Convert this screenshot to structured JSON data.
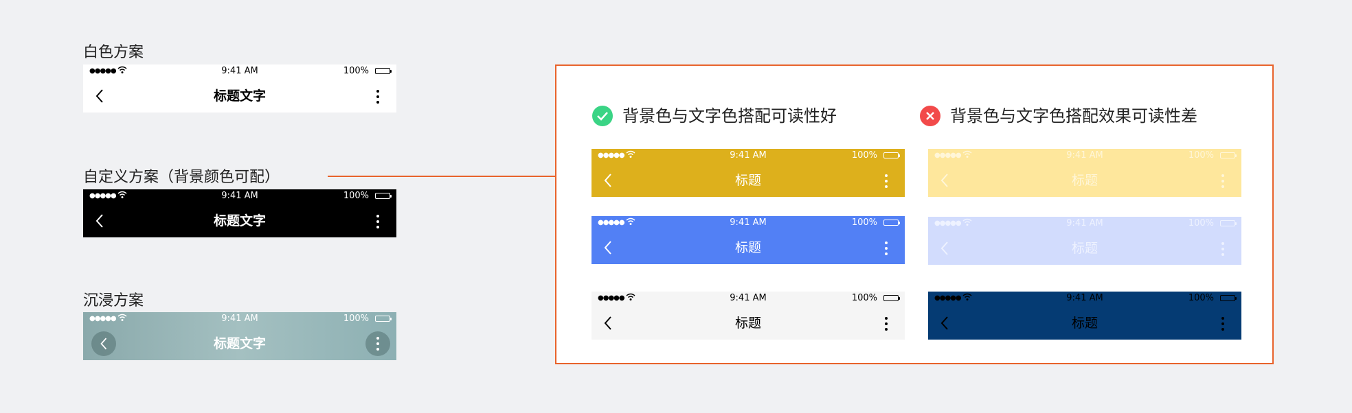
{
  "schemes": {
    "white_label": "白色方案",
    "custom_label": "自定义方案（背景颜色可配）",
    "immersive_label": "沉浸方案"
  },
  "statusbar": {
    "signal": "●●●●●",
    "time": "9:41 AM",
    "battery": "100%"
  },
  "navbar": {
    "title_full": "标题文字",
    "title_short": "标题"
  },
  "examples": {
    "good_heading": "背景色与文字色搭配可读性好",
    "bad_heading": "背景色与文字色搭配效果可读性差"
  },
  "colors": {
    "accent_orange": "#e8632b",
    "good_green": "#3ad485",
    "bad_red": "#f24a4a",
    "good_gold": "#ddb01c",
    "good_blue": "#5280f5",
    "good_light": "#f5f5f5",
    "bad_yellow": "#fee79c",
    "bad_lavender": "#d2dcfd",
    "bad_navy": "#053b73",
    "immersive_teal": "#8fb0b2"
  },
  "icons": [
    "check-icon",
    "close-icon",
    "chevron-left-icon",
    "more-vertical-icon",
    "wifi-icon",
    "battery-icon"
  ]
}
